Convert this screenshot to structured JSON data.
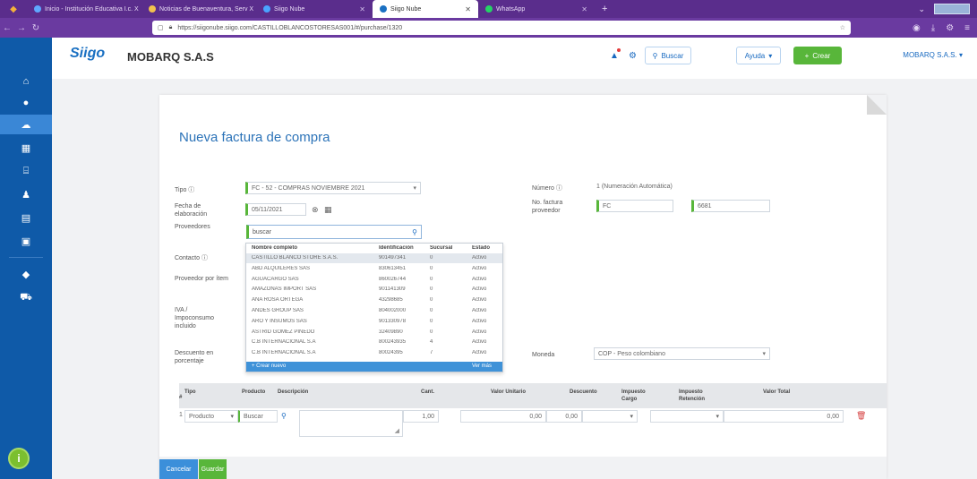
{
  "browser": {
    "tabs": [
      {
        "title": "Inicio - Institución Educativa I.c. X",
        "favicon_color": "#5fa8ff",
        "active": false
      },
      {
        "title": "Noticias de Buenaventura, Serv X",
        "favicon_color": "#f2c14e",
        "active": false
      },
      {
        "title": "Siigo Nube",
        "favicon_color": "#4aa3ff",
        "active": false
      },
      {
        "title": "Siigo Nube",
        "favicon_color": "#1a70c2",
        "active": true
      },
      {
        "title": "WhatsApp",
        "favicon_color": "#25d366",
        "active": false
      }
    ],
    "url": "https://siigonube.siigo.com/CASTILLOBLANCOSTORESAS001/#/purchase/1320"
  },
  "header": {
    "logo": "Siigo",
    "company": "MOBARQ S.A.S",
    "search_label": "Buscar",
    "help_label": "Ayuda",
    "create_label": "Crear",
    "user_menu": "MOBARQ S.A.S."
  },
  "form": {
    "title": "Nueva factura de compra",
    "tipo_label": "Tipo",
    "tipo_value": "FC - 52 - COMPRAS NOVIEMBRE 2021",
    "fecha_label": "Fecha de elaboración",
    "fecha_value": "05/11/2021",
    "proveedores_label": "Proveedores",
    "proveedores_search": "buscar",
    "contacto_label": "Contacto",
    "proveedor_item_label": "Proveedor por ítem",
    "iva_label": "IVA / Impoconsumo incluido",
    "descuento_label": "Descuento en porcentaje",
    "numero_label": "Número",
    "numero_value": "1 (Numeración Automática)",
    "nofactura_label": "No. factura proveedor",
    "nofactura_prefix": "FC",
    "nofactura_number": "6681",
    "moneda_label": "Moneda",
    "moneda_value": "COP - Peso colombiano"
  },
  "dropdown": {
    "headers": [
      "Nombre completo",
      "Identificación",
      "Sucursal",
      "Estado"
    ],
    "rows": [
      {
        "name": "CASTILLO BLANCO STORE S.A.S.",
        "id": "901497341",
        "branch": "0",
        "status": "Activo"
      },
      {
        "name": "ABD ALQUILERES SAS",
        "id": "830613451",
        "branch": "0",
        "status": "Activo"
      },
      {
        "name": "AGUACARGO SAS",
        "id": "860026744",
        "branch": "0",
        "status": "Activo"
      },
      {
        "name": "AMAZONAS IMPORT SAS",
        "id": "901141309",
        "branch": "0",
        "status": "Activo"
      },
      {
        "name": "ANA ROSA ORTEGA",
        "id": "43298685",
        "branch": "0",
        "status": "Activo"
      },
      {
        "name": "ANDES GROUP SAS",
        "id": "804002000",
        "branch": "0",
        "status": "Activo"
      },
      {
        "name": "ARO Y INSUMOS SAS",
        "id": "901330978",
        "branch": "0",
        "status": "Activo"
      },
      {
        "name": "ASTRID GOMEZ PINEDO",
        "id": "32409890",
        "branch": "0",
        "status": "Activo"
      },
      {
        "name": "C.B INTERNACIONAL S.A",
        "id": "800243935",
        "branch": "4",
        "status": "Activo"
      },
      {
        "name": "C.B INTERNACIONAL S.A",
        "id": "80024395",
        "branch": "7",
        "status": "Activo"
      }
    ],
    "create_label": "+ Crear nuevo",
    "more_label": "Ver más"
  },
  "table": {
    "headers": {
      "num": "#",
      "tipo": "Tipo",
      "producto": "Producto",
      "descripcion": "Descripción",
      "cant": "Cant.",
      "valor_unitario": "Valor Unitario",
      "descuento": "Descuento",
      "impuesto_cargo": "Impuesto Cargo",
      "impuesto_retencion": "Impuesto Retención",
      "valor_total": "Valor Total"
    },
    "row": {
      "num": "1",
      "tipo": "Producto",
      "producto": "Buscar",
      "cant": "1,00",
      "valor_unitario": "0,00",
      "descuento": "0,00",
      "valor_total": "0,00"
    }
  },
  "actions": {
    "cancel": "Cancelar",
    "save": "Guardar"
  }
}
